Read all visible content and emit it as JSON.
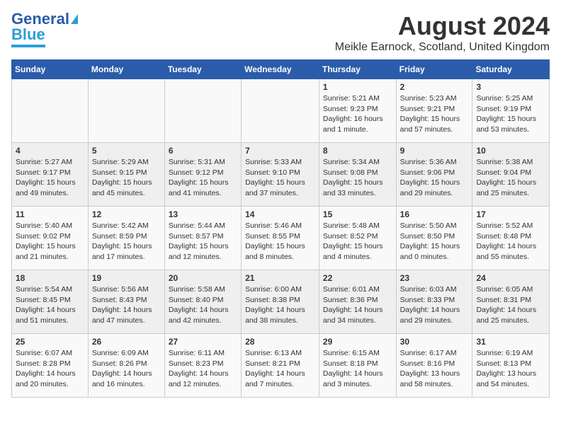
{
  "header": {
    "logo_line1": "General",
    "logo_line2": "Blue",
    "title": "August 2024",
    "subtitle": "Meikle Earnock, Scotland, United Kingdom"
  },
  "columns": [
    "Sunday",
    "Monday",
    "Tuesday",
    "Wednesday",
    "Thursday",
    "Friday",
    "Saturday"
  ],
  "weeks": [
    [
      {
        "day": "",
        "info": ""
      },
      {
        "day": "",
        "info": ""
      },
      {
        "day": "",
        "info": ""
      },
      {
        "day": "",
        "info": ""
      },
      {
        "day": "1",
        "info": "Sunrise: 5:21 AM\nSunset: 9:23 PM\nDaylight: 16 hours and 1 minute."
      },
      {
        "day": "2",
        "info": "Sunrise: 5:23 AM\nSunset: 9:21 PM\nDaylight: 15 hours and 57 minutes."
      },
      {
        "day": "3",
        "info": "Sunrise: 5:25 AM\nSunset: 9:19 PM\nDaylight: 15 hours and 53 minutes."
      }
    ],
    [
      {
        "day": "4",
        "info": "Sunrise: 5:27 AM\nSunset: 9:17 PM\nDaylight: 15 hours and 49 minutes."
      },
      {
        "day": "5",
        "info": "Sunrise: 5:29 AM\nSunset: 9:15 PM\nDaylight: 15 hours and 45 minutes."
      },
      {
        "day": "6",
        "info": "Sunrise: 5:31 AM\nSunset: 9:12 PM\nDaylight: 15 hours and 41 minutes."
      },
      {
        "day": "7",
        "info": "Sunrise: 5:33 AM\nSunset: 9:10 PM\nDaylight: 15 hours and 37 minutes."
      },
      {
        "day": "8",
        "info": "Sunrise: 5:34 AM\nSunset: 9:08 PM\nDaylight: 15 hours and 33 minutes."
      },
      {
        "day": "9",
        "info": "Sunrise: 5:36 AM\nSunset: 9:06 PM\nDaylight: 15 hours and 29 minutes."
      },
      {
        "day": "10",
        "info": "Sunrise: 5:38 AM\nSunset: 9:04 PM\nDaylight: 15 hours and 25 minutes."
      }
    ],
    [
      {
        "day": "11",
        "info": "Sunrise: 5:40 AM\nSunset: 9:02 PM\nDaylight: 15 hours and 21 minutes."
      },
      {
        "day": "12",
        "info": "Sunrise: 5:42 AM\nSunset: 8:59 PM\nDaylight: 15 hours and 17 minutes."
      },
      {
        "day": "13",
        "info": "Sunrise: 5:44 AM\nSunset: 8:57 PM\nDaylight: 15 hours and 12 minutes."
      },
      {
        "day": "14",
        "info": "Sunrise: 5:46 AM\nSunset: 8:55 PM\nDaylight: 15 hours and 8 minutes."
      },
      {
        "day": "15",
        "info": "Sunrise: 5:48 AM\nSunset: 8:52 PM\nDaylight: 15 hours and 4 minutes."
      },
      {
        "day": "16",
        "info": "Sunrise: 5:50 AM\nSunset: 8:50 PM\nDaylight: 15 hours and 0 minutes."
      },
      {
        "day": "17",
        "info": "Sunrise: 5:52 AM\nSunset: 8:48 PM\nDaylight: 14 hours and 55 minutes."
      }
    ],
    [
      {
        "day": "18",
        "info": "Sunrise: 5:54 AM\nSunset: 8:45 PM\nDaylight: 14 hours and 51 minutes."
      },
      {
        "day": "19",
        "info": "Sunrise: 5:56 AM\nSunset: 8:43 PM\nDaylight: 14 hours and 47 minutes."
      },
      {
        "day": "20",
        "info": "Sunrise: 5:58 AM\nSunset: 8:40 PM\nDaylight: 14 hours and 42 minutes."
      },
      {
        "day": "21",
        "info": "Sunrise: 6:00 AM\nSunset: 8:38 PM\nDaylight: 14 hours and 38 minutes."
      },
      {
        "day": "22",
        "info": "Sunrise: 6:01 AM\nSunset: 8:36 PM\nDaylight: 14 hours and 34 minutes."
      },
      {
        "day": "23",
        "info": "Sunrise: 6:03 AM\nSunset: 8:33 PM\nDaylight: 14 hours and 29 minutes."
      },
      {
        "day": "24",
        "info": "Sunrise: 6:05 AM\nSunset: 8:31 PM\nDaylight: 14 hours and 25 minutes."
      }
    ],
    [
      {
        "day": "25",
        "info": "Sunrise: 6:07 AM\nSunset: 8:28 PM\nDaylight: 14 hours and 20 minutes."
      },
      {
        "day": "26",
        "info": "Sunrise: 6:09 AM\nSunset: 8:26 PM\nDaylight: 14 hours and 16 minutes."
      },
      {
        "day": "27",
        "info": "Sunrise: 6:11 AM\nSunset: 8:23 PM\nDaylight: 14 hours and 12 minutes."
      },
      {
        "day": "28",
        "info": "Sunrise: 6:13 AM\nSunset: 8:21 PM\nDaylight: 14 hours and 7 minutes."
      },
      {
        "day": "29",
        "info": "Sunrise: 6:15 AM\nSunset: 8:18 PM\nDaylight: 14 hours and 3 minutes."
      },
      {
        "day": "30",
        "info": "Sunrise: 6:17 AM\nSunset: 8:16 PM\nDaylight: 13 hours and 58 minutes."
      },
      {
        "day": "31",
        "info": "Sunrise: 6:19 AM\nSunset: 8:13 PM\nDaylight: 13 hours and 54 minutes."
      }
    ]
  ]
}
